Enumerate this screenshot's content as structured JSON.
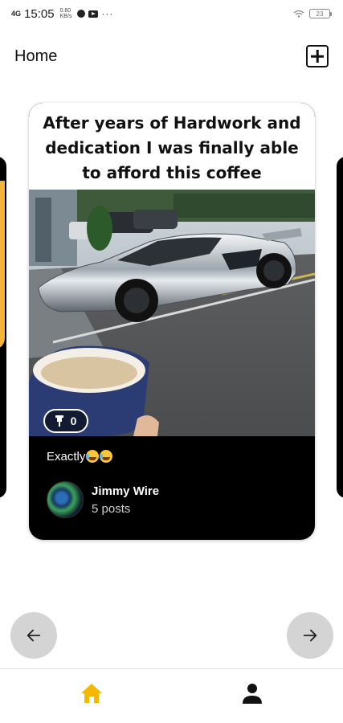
{
  "status_bar": {
    "signal": "4G",
    "time": "15:05",
    "net_speed_value": "0.60",
    "net_speed_unit": "KB/s",
    "more": "···",
    "battery": "23"
  },
  "header": {
    "title": "Home",
    "add_icon": "plus-square-icon"
  },
  "post": {
    "caption": "After years of Hardwork and dedication I was finally able to afford this coffee",
    "image_description_icon": "photo",
    "pin_count": "0",
    "text": "Exactly",
    "author": {
      "name": "Jimmy Wire",
      "posts": "5 posts"
    }
  },
  "navigation": {
    "prev_icon": "arrow-left-icon",
    "next_icon": "arrow-right-icon"
  },
  "bottom_nav": {
    "home_icon": "home-icon",
    "profile_icon": "person-icon",
    "active_color": "#f5b800",
    "inactive_color": "#111111"
  }
}
